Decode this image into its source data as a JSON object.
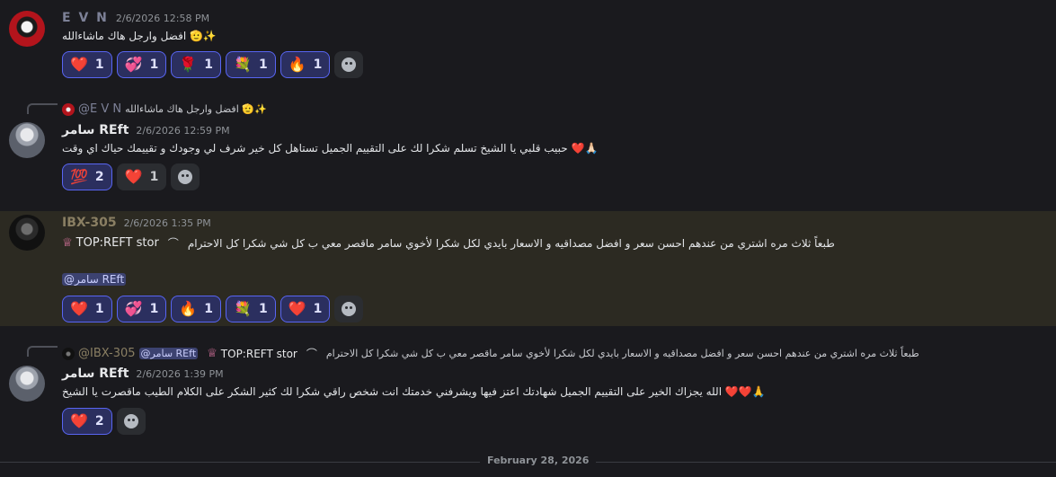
{
  "messages": {
    "m1": {
      "author": "E V N",
      "timestamp": "2/6/2026 12:58 PM",
      "text": "افضل وارجل هاك ماشاءالله 🫡✨",
      "reactions": [
        {
          "emoji": "❤️",
          "count": "1"
        },
        {
          "emoji": "💞",
          "count": "1"
        },
        {
          "emoji": "🌹",
          "count": "1"
        },
        {
          "emoji": "💐",
          "count": "1"
        },
        {
          "emoji": "🔥",
          "count": "1"
        }
      ]
    },
    "m2": {
      "reply_to_name": "@E V N",
      "reply_to_text": "افضل وارجل هاك ماشاءالله 🫡✨",
      "author": "سامر REft",
      "timestamp": "2/6/2026 12:59 PM",
      "text": "حبيب قلبي يا الشيخ تسلم شكرا لك على التقييم الجميل تستاهل كل خير شرف لي وجودك و تقييمك حياك اي وقت ❤️🙏🏻",
      "reactions": [
        {
          "emoji": "💯",
          "count": "2"
        },
        {
          "emoji": "❤️",
          "count": "1"
        }
      ]
    },
    "m3": {
      "author": "IBX-305",
      "timestamp": "2/6/2026 1:35 PM",
      "role_tag": "TOP:REFT stor",
      "text": "طبعاً ثلاث مره اشتري من عندهم احسن سعر و افضل مصداقيه و الاسعار بايدي لكل شكرا لأخوي سامر ماقصر معي ب كل شي شكرا كل الاحترام",
      "mention": "@سامر REft",
      "reactions": [
        {
          "emoji": "❤️",
          "count": "1"
        },
        {
          "emoji": "💞",
          "count": "1"
        },
        {
          "emoji": "🔥",
          "count": "1"
        },
        {
          "emoji": "💐",
          "count": "1"
        },
        {
          "emoji": "❤️",
          "count": "1"
        }
      ]
    },
    "m4": {
      "reply_to_name": "@IBX-305",
      "reply_mention": "@سامر REft",
      "reply_role_tag": "TOP:REFT stor",
      "reply_to_text": "طبعاً ثلاث مره اشتري من عندهم احسن سعر و افضل مصداقيه و الاسعار بايدي لكل شكرا لأخوي سامر ماقصر معي ب كل شي شكرا كل الاحترام",
      "author": "سامر REft",
      "timestamp": "2/6/2026 1:39 PM",
      "text": "الله يجزاك الخير على التقييم الجميل شهادتك اعتز فيها ويشرفني خدمتك انت شخص راقي شكرا لك كثير الشكر على الكلام الطيب ماقصرت يا الشيخ ❤️❤️🙏",
      "reactions": [
        {
          "emoji": "❤️",
          "count": "2"
        }
      ]
    }
  },
  "date_divider": "February 28, 2026"
}
